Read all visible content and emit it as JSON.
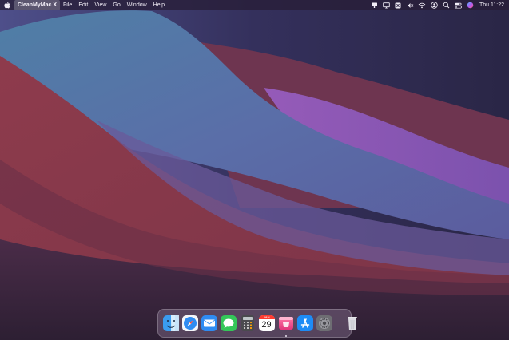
{
  "menubar": {
    "app_name": "CleanMyMac X",
    "menus": [
      "File",
      "Edit",
      "View",
      "Go",
      "Window",
      "Help"
    ],
    "clock": "Thu 11:22",
    "status_icons": [
      "display-icon",
      "screen-mirror-icon",
      "bracket-app-icon",
      "sound-off-icon",
      "wifi-icon",
      "user-icon",
      "spotlight-search-icon",
      "control-center-icon",
      "siri-icon"
    ]
  },
  "dock": {
    "apps": [
      "finder",
      "safari",
      "mail",
      "messages",
      "calculator",
      "calendar",
      "cleanmymac",
      "app-store",
      "system-preferences"
    ],
    "calendar_month": "JAN",
    "calendar_day": "29",
    "trash": "trash"
  },
  "colors": {
    "menubar_bg": "#281e37",
    "wallpaper_dark": "#2a2340",
    "wallpaper_red": "#8a3a4a",
    "wallpaper_purple": "#8a5fc0"
  }
}
